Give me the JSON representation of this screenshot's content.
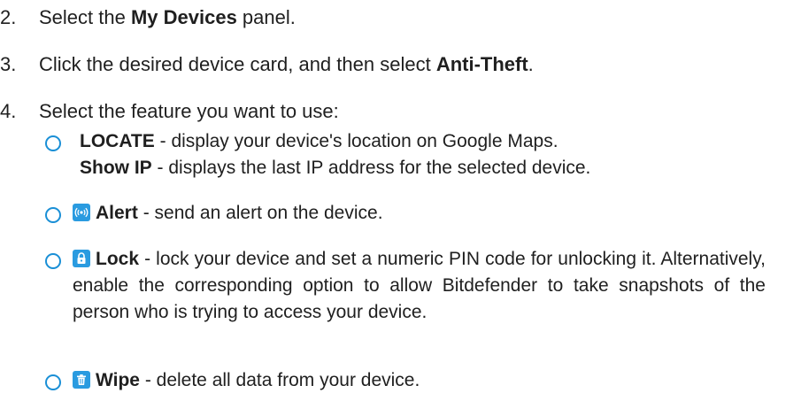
{
  "steps": [
    {
      "num": "2.",
      "pre": "Select the ",
      "bold": "My Devices",
      "post": " panel."
    },
    {
      "num": "3.",
      "pre": "Click the desired device card, and then select ",
      "bold": "Anti-Theft",
      "post": "."
    },
    {
      "num": "4.",
      "text": "Select the feature you want to use:"
    }
  ],
  "features": [
    {
      "bold": "LOCATE",
      "text": " - display your device's location on Google Maps.",
      "sub_bold": "Show IP",
      "sub_text": " - displays the last IP address for the selected device."
    },
    {
      "icon": "alert-icon",
      "bold": "Alert",
      "text": " - send an alert on the device."
    },
    {
      "icon": "lock-icon",
      "bold": "Lock",
      "text": " - lock your device and set a numeric PIN code for unlocking it. Alternatively, enable the corresponding option to allow Bitdefender to take snapshots of the person who is trying to access your device."
    },
    {
      "icon": "trash-icon",
      "bold": "Wipe",
      "text": " - delete all data from your device."
    }
  ],
  "colors": {
    "accent": "#1a8fd6",
    "icon_bg": "#2a9be0",
    "text": "#1f1f1f"
  }
}
